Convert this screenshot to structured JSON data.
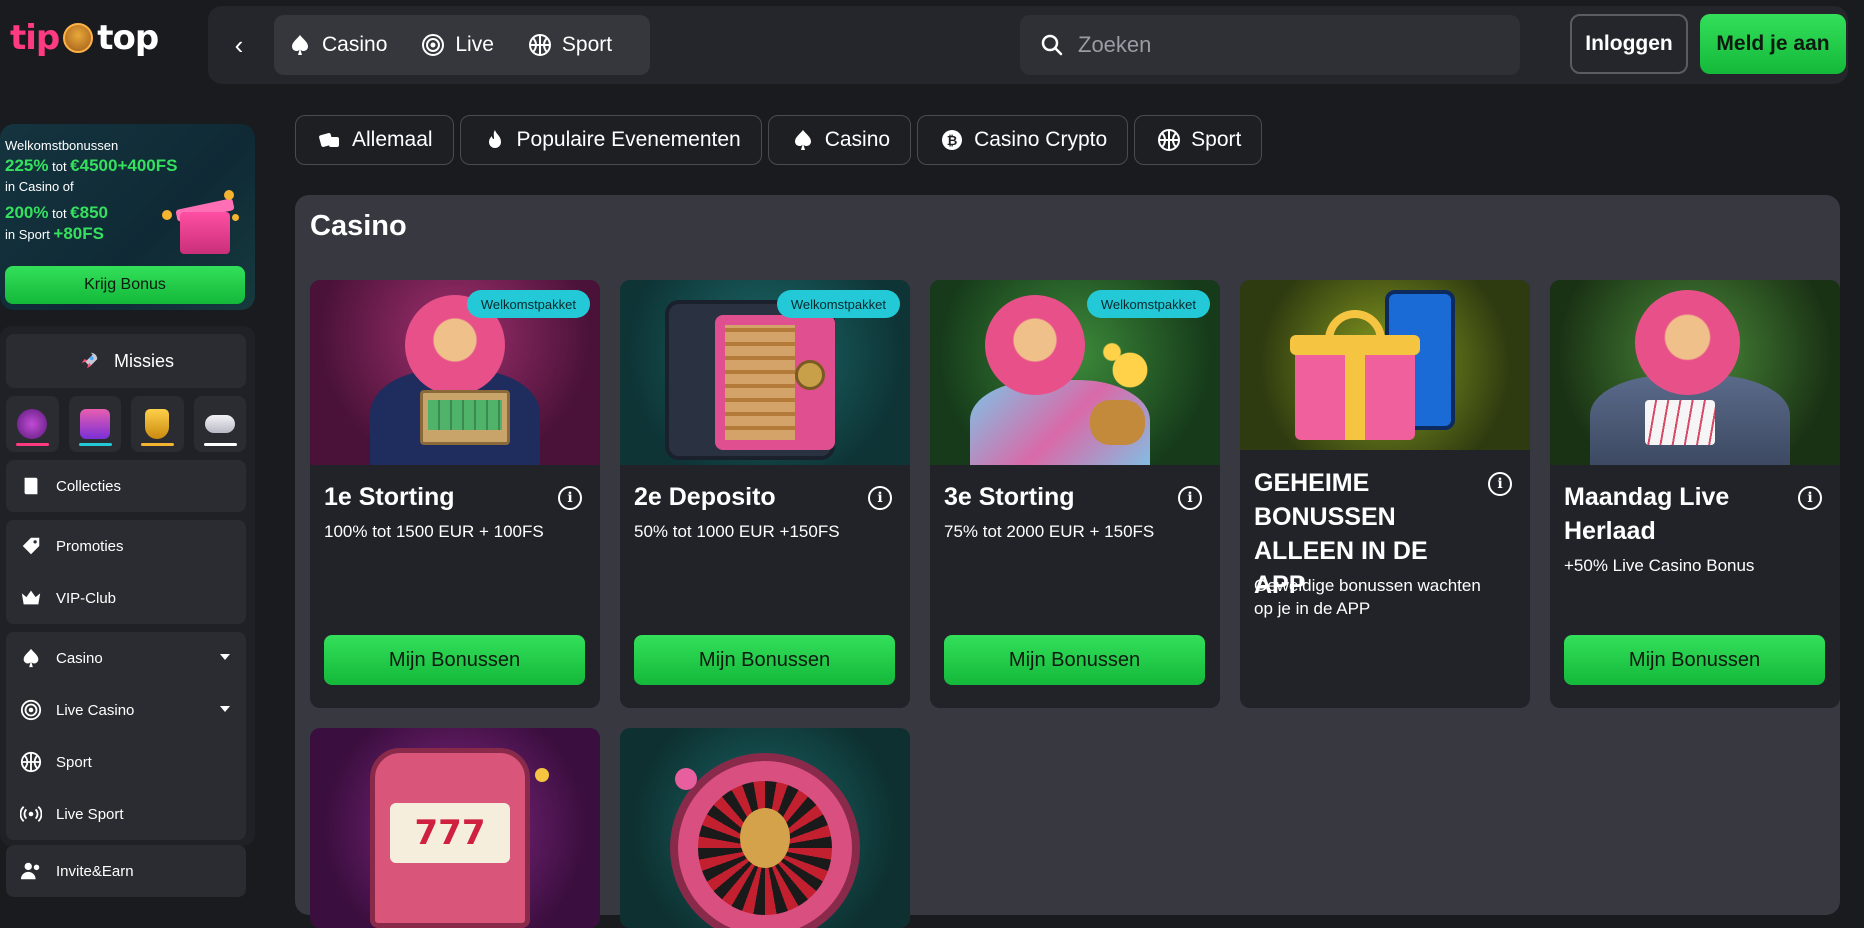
{
  "brand": {
    "tip": "tip",
    "top": "top"
  },
  "header": {
    "nav": [
      {
        "label": "Casino",
        "icon": "spade-icon"
      },
      {
        "label": "Live",
        "icon": "live-chip-icon"
      },
      {
        "label": "Sport",
        "icon": "ball-icon"
      }
    ],
    "search_placeholder": "Zoeken",
    "login_label": "Inloggen",
    "signup_label": "Meld je aan"
  },
  "promo": {
    "line1": "Welkomstbonussen",
    "line2_big": "225%",
    "line2_mid": " tot ",
    "line2_big2": "€4500+400FS",
    "line3": "in Casino of",
    "line4_big": "200%",
    "line4_mid": " tot ",
    "line4_big2": "€850",
    "line5_small": "in Sport ",
    "line5_big": "+80FS",
    "button_label": "Krijg Bonus"
  },
  "sidebar": {
    "missions_label": "Missies",
    "mission_bar_colors": [
      "#ff3b7f",
      "#23c9d6",
      "#f5b430",
      "#ffffff"
    ],
    "group1": [
      {
        "label": "Collecties"
      }
    ],
    "group2": [
      {
        "label": "Promoties"
      },
      {
        "label": "VIP-Club"
      }
    ],
    "group3": [
      {
        "label": "Casino"
      },
      {
        "label": "Live Casino"
      },
      {
        "label": "Sport"
      },
      {
        "label": "Live Sport"
      }
    ],
    "group4": [
      {
        "label": "Invite&Earn"
      }
    ]
  },
  "filters": [
    {
      "label": "Allemaal"
    },
    {
      "label": "Populaire Evenementen"
    },
    {
      "label": "Casino"
    },
    {
      "label": "Casino Crypto"
    },
    {
      "label": "Sport"
    }
  ],
  "main": {
    "title": "Casino",
    "cards": [
      {
        "badge": "Welkomstpakket",
        "title": "1e Storting",
        "desc": "100% tot 1500 EUR + 100FS",
        "cta": "Mijn Bonussen"
      },
      {
        "badge": "Welkomstpakket",
        "title": "2e Deposito",
        "desc": "50% tot 1000 EUR +150FS",
        "cta": "Mijn Bonussen"
      },
      {
        "badge": "Welkomstpakket",
        "title": "3e Storting",
        "desc": "75% tot 2000 EUR + 150FS",
        "cta": "Mijn Bonussen"
      },
      {
        "title": "GEHEIME BONUSSEN ALLEEN IN DE APP",
        "desc": "Geweldige bonussen wachten op je in de APP"
      },
      {
        "title": "Maandag Live Herlaad",
        "desc": "+50% Live Casino Bonus",
        "cta": "Mijn Bonussen"
      }
    ]
  }
}
